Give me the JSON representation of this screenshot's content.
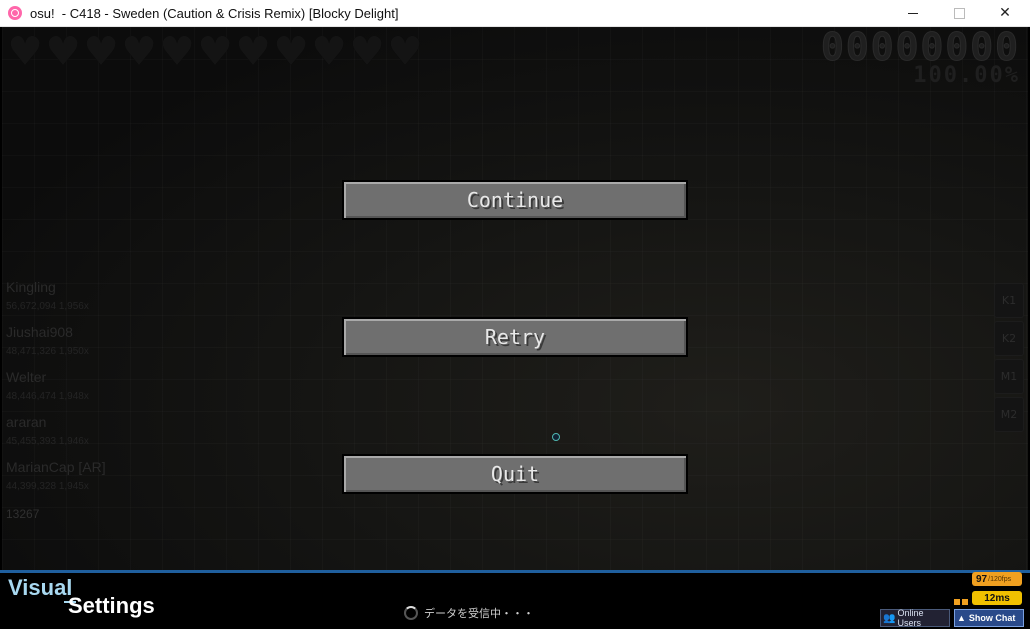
{
  "window": {
    "title": "osu!  - C418 - Sweden (Caution & Crisis Remix) [Blocky Delight]",
    "min_icon": "minimize-icon",
    "max_icon": "maximize-icon",
    "close_icon": "close-icon",
    "close_glyph": "✕"
  },
  "hud": {
    "score": "00000000",
    "accuracy": "100.00%",
    "hearts": [
      "♥",
      "♥",
      "♥",
      "♥",
      "♥",
      "♥",
      "♥",
      "♥",
      "♥",
      "♥",
      "♥"
    ]
  },
  "leaderboard": {
    "entries": [
      {
        "name": "Kingling",
        "score": "56,672,094  1,956x"
      },
      {
        "name": "Jiushai908",
        "score": "48,471,326  1,950x"
      },
      {
        "name": "Welter",
        "score": "48,446,474  1,948x"
      },
      {
        "name": "araran",
        "score": "45,455,393  1,946x"
      },
      {
        "name": "MarianCap [AR]",
        "score": "44,399,328  1,945x"
      }
    ],
    "player_count": "13267"
  },
  "keys": [
    "K1",
    "K2",
    "M1",
    "M2"
  ],
  "pause_menu": {
    "continue_label": "Continue",
    "retry_label": "Retry",
    "quit_label": "Quit"
  },
  "bottom": {
    "visual": "Visual",
    "settings": "Settings",
    "loading_text": "データを受信中・・・",
    "fps_value": "97",
    "fps_cap": "/120fps",
    "latency": "12ms",
    "online_users": "Online Users",
    "show_chat": "Show Chat"
  },
  "colors": {
    "accent_blue": "#1f5f9e",
    "fps_orange": "#f0a020",
    "latency_yellow": "#f0c000",
    "visual_blue": "#a8d8f0"
  }
}
